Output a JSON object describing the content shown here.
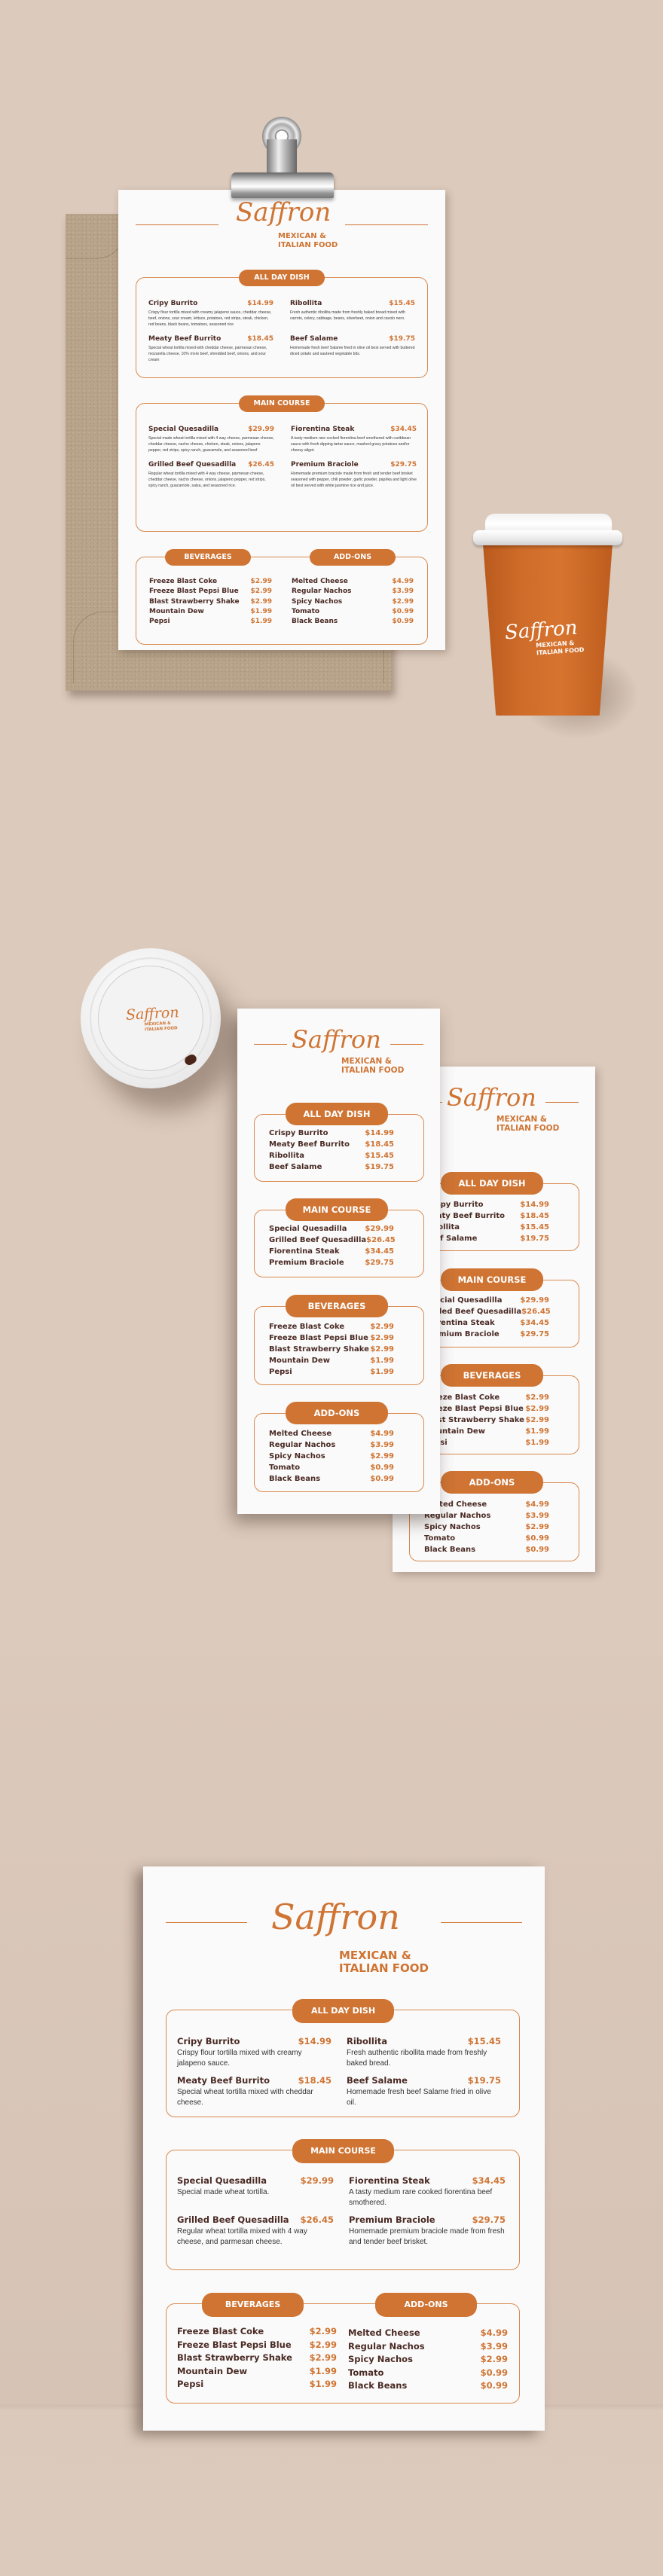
{
  "brand": {
    "name": "Saffron",
    "tagline_line1": "MEXICAN &",
    "tagline_line2": "ITALIAN FOOD"
  },
  "colors": {
    "accent": "#cf7433",
    "text_dark": "#4a2a24",
    "background": "#dccabc",
    "paper": "#fafafa",
    "kraft": "#b8a48a"
  },
  "sections": {
    "all_day": "ALL DAY DISH",
    "main_course": "MAIN COURSE",
    "beverages": "BEVERAGES",
    "addons": "ADD-ONS"
  },
  "clipboard_menu": {
    "all_day": [
      {
        "name": "Cripy Burrito",
        "price": "$14.99",
        "desc": "Crispy flour tortilla mixed with creamy jalapeno sauce, cheddar cheese, beef, onions, sour cream, lettuce, potatoes, red strips, steak, chicken, red beans, black beans, tomatoes, seasoned rice"
      },
      {
        "name": "Ribollita",
        "price": "$15.45",
        "desc": "Fresh authentic ribollita made from freshly baked bread mixed with carrots, celery, cabbage, beans, silverbeet, onion and cavolo nero."
      },
      {
        "name": "Meaty Beef Burrito",
        "price": "$18.45",
        "desc": "Special wheat tortilla mixed with cheddar cheese, parmesan cheese, mozarella cheese, 10% more beef, shredded beef, onions, and sour cream"
      },
      {
        "name": "Beef Salame",
        "price": "$19.75",
        "desc": "Homemade fresh beef Salame fried in olive oil best served with buttered diced potato and sauteed vegetable bits."
      }
    ],
    "main_course": [
      {
        "name": "Special Quesadilla",
        "price": "$29.99",
        "desc": "Special made wheat tortilla mixed with 4 way cheese, parmesan cheese, cheddar cheese, nacho cheese, chicken, steak, onions, jalapeno pepper, red strips, spicy ranch, guacamole, and seasoned beef"
      },
      {
        "name": "Fiorentina Steak",
        "price": "$34.45",
        "desc": "A tasty medium rare cocked fiorentina beef smothered with caribbean sauce with fresh dipping tartar sauce, mashed gravy potatoes and/or cheesy aligot."
      },
      {
        "name": "Grilled Beef Quesadilla",
        "price": "$26.45",
        "desc": "Regular wheat tortilla mixed with 4 way cheese, parmesan cheese, cheddar cheese, nacho cheese, onions, jalapeno pepper, red strips, spicy ranch, guacamole, salsa, and seasoned rice."
      },
      {
        "name": "Premium Braciole",
        "price": "$29.75",
        "desc": "Homemade premium braciole made from fresh and tender beef brisket seasoned with pepper, chili powder, garlic powder, paprika and light olive oil best served with white jasmine rice and juice."
      }
    ]
  },
  "dl_menu": {
    "all_day": [
      {
        "name": "Crispy Burrito",
        "price": "$14.99"
      },
      {
        "name": "Meaty Beef Burrito",
        "price": "$18.45"
      },
      {
        "name": "Ribollita",
        "price": "$15.45"
      },
      {
        "name": "Beef Salame",
        "price": "$19.75"
      }
    ],
    "main_course": [
      {
        "name": "Special Quesadilla",
        "price": "$29.99"
      },
      {
        "name": "Grilled Beef Quesadilla",
        "price": "$26.45"
      },
      {
        "name": "Fiorentina Steak",
        "price": "$34.45"
      },
      {
        "name": "Premium Braciole",
        "price": "$29.75"
      }
    ]
  },
  "beverages": [
    {
      "name": "Freeze Blast Coke",
      "price": "$2.99"
    },
    {
      "name": "Freeze Blast Pepsi Blue",
      "price": "$2.99"
    },
    {
      "name": "Blast Strawberry Shake",
      "price": "$2.99"
    },
    {
      "name": "Mountain Dew",
      "price": "$1.99"
    },
    {
      "name": "Pepsi",
      "price": "$1.99"
    }
  ],
  "addons": [
    {
      "name": "Melted Cheese",
      "price": "$4.99"
    },
    {
      "name": "Regular Nachos",
      "price": "$3.99"
    },
    {
      "name": "Spicy Nachos",
      "price": "$2.99"
    },
    {
      "name": "Tomato",
      "price": "$0.99"
    },
    {
      "name": "Black Beans",
      "price": "$0.99"
    }
  ],
  "poster_menu": {
    "all_day": [
      {
        "name": "Cripy Burrito",
        "price": "$14.99",
        "desc": "Crispy flour tortilla mixed with creamy jalapeno sauce."
      },
      {
        "name": "Ribollita",
        "price": "$15.45",
        "desc": "Fresh authentic ribollita made from freshly baked bread."
      },
      {
        "name": "Meaty Beef Burrito",
        "price": "$18.45",
        "desc": "Special wheat tortilla mixed with cheddar cheese."
      },
      {
        "name": "Beef Salame",
        "price": "$19.75",
        "desc": "Homemade fresh beef Salame fried in olive oil."
      }
    ],
    "main_course": [
      {
        "name": "Special Quesadilla",
        "price": "$29.99",
        "desc": "Special made wheat tortilla."
      },
      {
        "name": "Fiorentina Steak",
        "price": "$34.45",
        "desc": "A tasty medium rare cooked fiorentina beef smothered."
      },
      {
        "name": "Grilled Beef Quesadilla",
        "price": "$26.45",
        "desc": "Regular wheat tortilla mixed with 4 way cheese,  and parmesan cheese."
      },
      {
        "name": "Premium Braciole",
        "price": "$29.75",
        "desc": "Homemade premium braciole made from fresh and tender beef brisket."
      }
    ]
  }
}
